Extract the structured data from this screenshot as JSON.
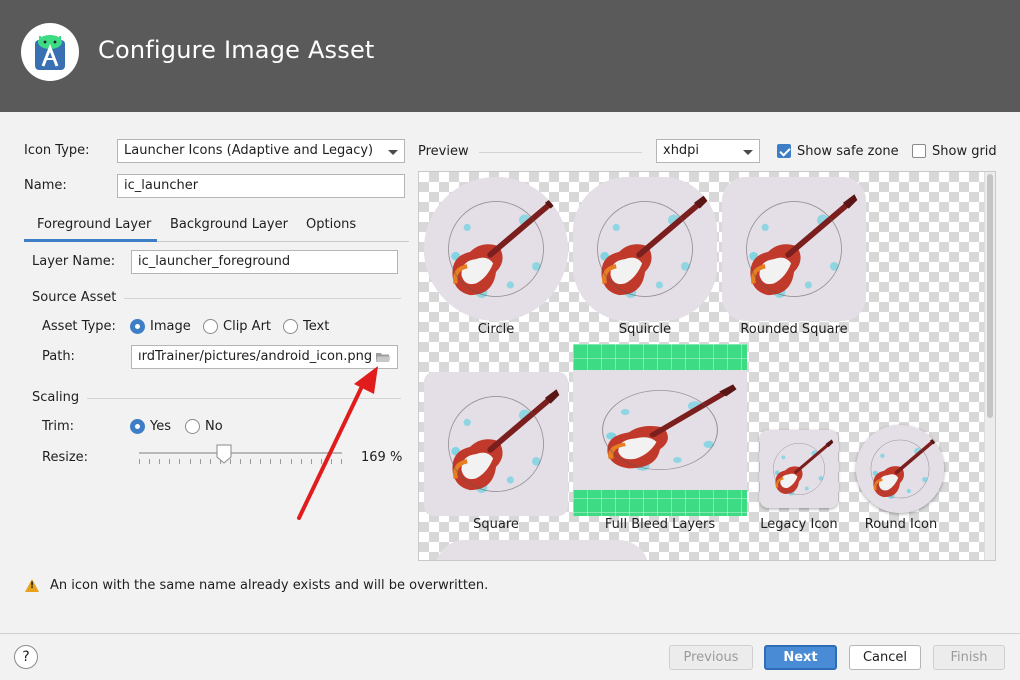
{
  "window": {
    "title": "Configure Image Asset"
  },
  "form": {
    "icon_type_label": "Icon Type:",
    "icon_type_value": "Launcher Icons (Adaptive and Legacy)",
    "name_label": "Name:",
    "name_value": "ic_launcher"
  },
  "tabs": [
    {
      "label": "Foreground Layer",
      "active": true
    },
    {
      "label": "Background Layer",
      "active": false
    },
    {
      "label": "Options",
      "active": false
    }
  ],
  "layer": {
    "layer_name_label": "Layer Name:",
    "layer_name_value": "ic_launcher_foreground"
  },
  "source_asset": {
    "section_label": "Source Asset",
    "asset_type_label": "Asset Type:",
    "options": [
      "Image",
      "Clip Art",
      "Text"
    ],
    "selected": "Image",
    "path_label": "Path:",
    "path_value": "ırdTrainer/pictures/android_icon.png"
  },
  "scaling": {
    "section_label": "Scaling",
    "trim_label": "Trim:",
    "trim_options": [
      "Yes",
      "No"
    ],
    "trim_selected": "Yes",
    "resize_label": "Resize:",
    "resize_value_text": "169 %",
    "resize_fraction": 0.42
  },
  "preview": {
    "label": "Preview",
    "density_value": "xhdpi",
    "show_safe_zone_label": "Show safe zone",
    "show_safe_zone_checked": true,
    "show_grid_label": "Show grid",
    "show_grid_checked": false,
    "captions": [
      "Circle",
      "Squircle",
      "Rounded Square",
      "Square",
      "Full Bleed Layers",
      "Legacy Icon",
      "Round Icon"
    ]
  },
  "warning": {
    "text": "An icon with the same name already exists and will be overwritten."
  },
  "footer": {
    "help_label": "?",
    "previous_label": "Previous",
    "next_label": "Next",
    "cancel_label": "Cancel",
    "finish_label": "Finish"
  },
  "colors": {
    "header_bg": "#5a5a5a",
    "accent": "#3d7ec7",
    "primary_button": "#4a8bd6",
    "full_bleed_green": "#3ddc84",
    "annotation_arrow": "#e11c1c",
    "warning": "#e6a21a"
  },
  "icons": {
    "logo": "android-studio-logo-icon",
    "folder": "folder-open-icon",
    "combo_arrow": "chevron-down-icon",
    "warning": "warning-triangle-icon",
    "help": "help-icon"
  }
}
